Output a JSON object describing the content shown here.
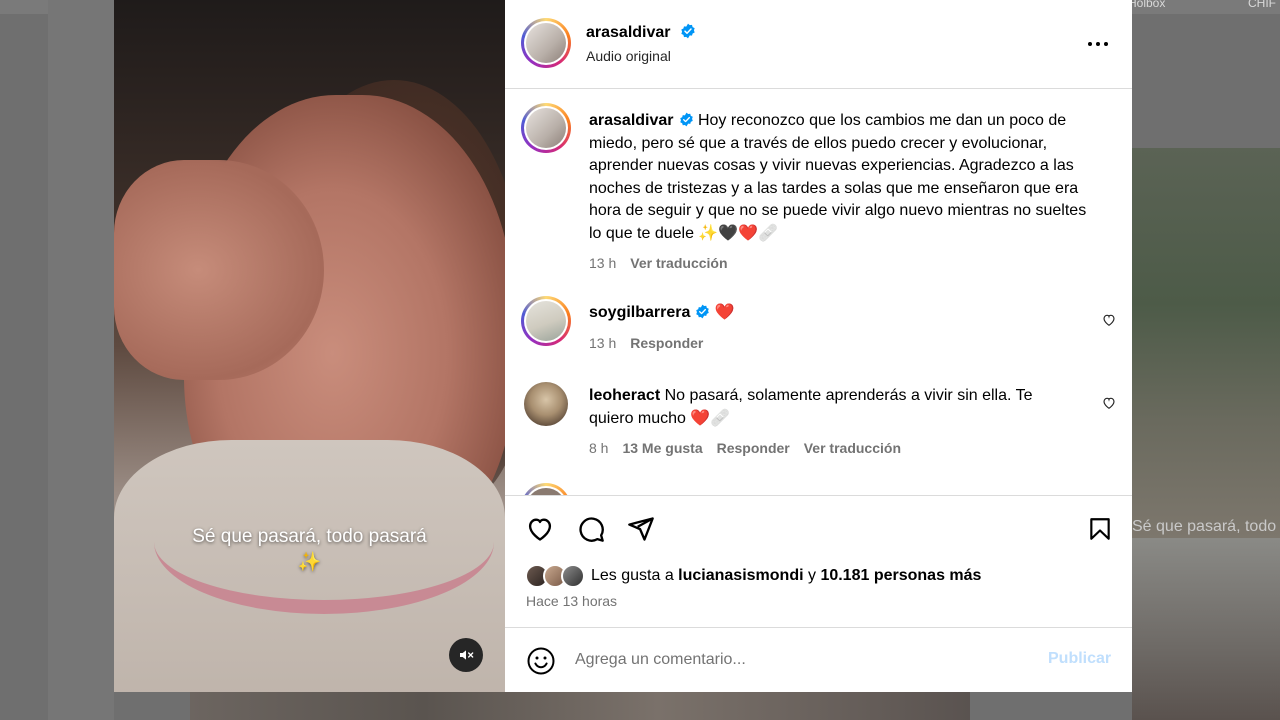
{
  "background": {
    "top_labels": [
      "Holbox",
      "CHIF"
    ],
    "right_caption": "Sé que pasará, todo pasará"
  },
  "media": {
    "caption_line1": "Sé que pasará, todo pasará",
    "caption_line2": "✨",
    "mute_icon": "speaker-muted-icon"
  },
  "post": {
    "header": {
      "username": "arasaldivar",
      "subtitle": "Audio original",
      "verified": true
    },
    "caption": {
      "username": "arasaldivar",
      "text": "Hoy reconozco que los cambios me dan un poco de miedo, pero sé que a través de ellos puedo crecer y evolucionar, aprender nuevas cosas y vivir nuevas experiencias. Agradezco a las noches de tristezas y a las tardes a solas que me enseñaron que era hora de seguir y que no se puede vivir algo nuevo mientras no sueltes lo que te duele ✨🖤❤️🩹",
      "time": "13 h",
      "translate": "Ver traducción"
    },
    "comments": [
      {
        "username": "soygilbarrera",
        "text": "❤️",
        "time": "13 h",
        "reply": "Responder"
      },
      {
        "username": "leoheract",
        "text": "No pasará, solamente aprenderás a vivir sin ella. Te quiero mucho ❤️🩹",
        "time": "8 h",
        "likes": "13 Me gusta",
        "reply": "Responder",
        "translate": "Ver traducción"
      }
    ],
    "likes": {
      "prefix": "Les gusta a ",
      "user": "lucianasismondi",
      "middle": " y ",
      "count": "10.181 personas más"
    },
    "time_ago": "Hace 13 horas",
    "composer": {
      "placeholder": "Agrega un comentario...",
      "publish": "Publicar"
    }
  },
  "colors": {
    "verified_blue": "#0095f6",
    "heart_red": "#ed4956",
    "publish_disabled": "#c0dffd",
    "meta_gray": "#737373"
  }
}
